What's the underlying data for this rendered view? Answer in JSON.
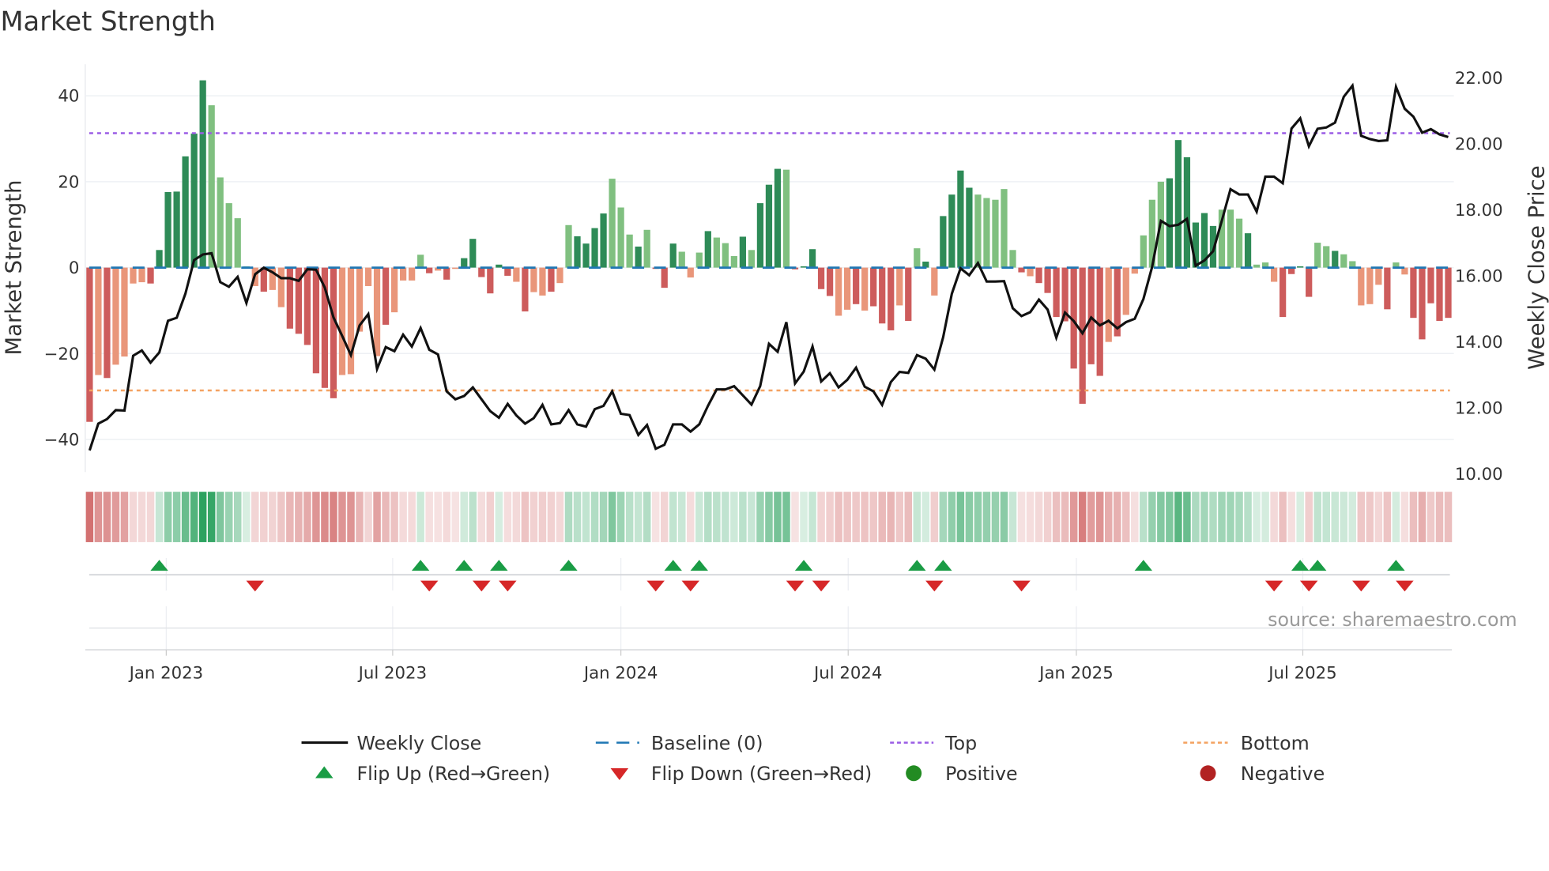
{
  "chart_data": {
    "type": "bar",
    "title": "Market Strength",
    "ylabel": "Market Strength",
    "y2label": "Weekly Close Price",
    "source": "source: sharemaestro.com",
    "ylim": [
      -44,
      47
    ],
    "y2lim": [
      10,
      22.3
    ],
    "yticks": [
      40,
      20,
      0,
      -20,
      -40
    ],
    "ytick_labels": [
      "40",
      "20",
      "0",
      "−20",
      "−40"
    ],
    "y2ticks": [
      22,
      20,
      18,
      16,
      14,
      12,
      10
    ],
    "y2tick_labels": [
      "22.00",
      "20.00",
      "18.00",
      "16.00",
      "14.00",
      "12.00",
      "10.00"
    ],
    "xticks": [
      {
        "label": "Jan 2023",
        "week": 8.8
      },
      {
        "label": "Jul 2023",
        "week": 34.8
      },
      {
        "label": "Jan 2024",
        "week": 61.0
      },
      {
        "label": "Jul 2024",
        "week": 87.1
      },
      {
        "label": "Jan 2025",
        "week": 113.3
      },
      {
        "label": "Jul 2025",
        "week": 139.3
      }
    ],
    "grid": true,
    "top_level": 31.3,
    "bottom_level": -28.6,
    "baseline": 0,
    "colors": {
      "positive_strong": "#2e8b57",
      "positive_weak": "#80c080",
      "negative_strong": "#cd5c5c",
      "negative_weak": "#e9967a",
      "price": "#111111",
      "baseline": "#1f77b4",
      "top": "#9b5de5",
      "bottom": "#f4a261",
      "flip_up": "#1a9c45",
      "flip_down": "#d62728",
      "positive_dot": "#228b22",
      "negative_dot": "#b22222"
    },
    "strength": [
      -35.9,
      -25,
      -25.7,
      -22.6,
      -20.7,
      -3.7,
      -3.4,
      -3.7,
      4.1,
      17.6,
      17.7,
      25.9,
      31.2,
      43.6,
      37.8,
      21,
      15,
      11.5,
      0.3,
      -4.3,
      -5.6,
      -5.2,
      -9.2,
      -14.2,
      -15.4,
      -18,
      -24.6,
      -28,
      -30.4,
      -25,
      -24.8,
      -14.9,
      -4.3,
      -20.6,
      -13.3,
      -10.4,
      -3,
      -3,
      3,
      -1.3,
      -0.7,
      -2.8,
      -0.3,
      2.2,
      6.7,
      -2.2,
      -6,
      0.7,
      -1.9,
      -3.3,
      -10.2,
      -5.7,
      -6.5,
      -5.6,
      -3.6,
      9.9,
      7.3,
      5.6,
      9.2,
      12.6,
      20.7,
      14,
      7.7,
      4.9,
      8.8,
      -0.3,
      -4.7,
      5.6,
      3.7,
      -2.3,
      3.5,
      8.5,
      7,
      5.7,
      2.7,
      7.2,
      4.1,
      15,
      19.3,
      23,
      22.8,
      -0.4,
      0.3,
      4.3,
      -5,
      -6.6,
      -11.2,
      -9.8,
      -8.5,
      -10,
      -9,
      -13,
      -14.6,
      -8.8,
      -12.4,
      4.5,
      1.4,
      -6.5,
      12,
      17,
      22.6,
      18.6,
      17,
      16.2,
      15.8,
      18.3,
      4.1,
      -1.1,
      -2,
      -3.6,
      -5.9,
      -11.5,
      -12.5,
      -23.5,
      -31.7,
      -22.5,
      -25.2,
      -17.3,
      -16,
      -11,
      -1.4,
      7.5,
      15.8,
      20,
      20.8,
      29.7,
      25.7,
      10.5,
      12.7,
      9.7,
      13.5,
      13.5,
      11.4,
      8,
      0.7,
      1.2,
      -3.3,
      -11.5,
      -1.5,
      0.3,
      -6.8,
      5.8,
      5,
      3.9,
      3.1,
      1.5,
      -8.8,
      -8.5,
      -4,
      -9.7,
      1.2,
      -1.6,
      -11.7,
      -16.7,
      -8.3,
      -12.4,
      -11.7
    ],
    "shade": "dldlllldddddddlllllldllddddddllllldlllldldlddddddldlldllddddllldldddllldllldldddldddddlldldddldldlddddllllldlddddddddldlllllddddddllldlllddddlldllllldlldddddlll",
    "weekly_close": [
      10.68,
      11.49,
      11.63,
      11.9,
      11.89,
      13.55,
      13.71,
      13.34,
      13.65,
      14.61,
      14.7,
      15.43,
      16.45,
      16.62,
      16.66,
      15.78,
      15.64,
      15.94,
      15.15,
      16.02,
      16.22,
      16.08,
      15.9,
      15.9,
      15.82,
      16.17,
      16.16,
      15.62,
      14.71,
      14.15,
      13.57,
      14.47,
      14.81,
      13.15,
      13.81,
      13.69,
      14.19,
      13.83,
      14.39,
      13.73,
      13.59,
      12.47,
      12.23,
      12.33,
      12.59,
      12.23,
      11.87,
      11.67,
      12.09,
      11.74,
      11.49,
      11.66,
      12.06,
      11.47,
      11.51,
      11.9,
      11.47,
      11.4,
      11.93,
      12.03,
      12.47,
      11.79,
      11.75,
      11.15,
      11.45,
      10.73,
      10.85,
      11.47,
      11.47,
      11.25,
      11.47,
      12.03,
      12.53,
      12.53,
      12.63,
      12.35,
      12.07,
      12.63,
      13.91,
      13.67,
      14.57,
      12.71,
      13.07,
      13.83,
      12.77,
      13.02,
      12.59,
      12.82,
      13.19,
      12.61,
      12.47,
      12.06,
      12.75,
      13.06,
      13.03,
      13.57,
      13.46,
      13.13,
      14.11,
      15.43,
      16.2,
      15.99,
      16.36,
      15.8,
      15.8,
      15.81,
      14.99,
      14.75,
      14.87,
      15.25,
      14.95,
      14.1,
      14.86,
      14.6,
      14.23,
      14.71,
      14.47,
      14.61,
      14.38,
      14.57,
      14.67,
      15.27,
      16.24,
      17.64,
      17.48,
      17.52,
      17.7,
      16.28,
      16.44,
      16.72,
      17.64,
      18.6,
      18.44,
      18.44,
      17.92,
      18.98,
      18.98,
      18.78,
      20.44,
      20.75,
      19.9,
      20.43,
      20.47,
      20.62,
      21.4,
      21.74,
      20.22,
      20.12,
      20.06,
      20.08,
      21.7,
      21.04,
      20.8,
      20.31,
      20.42,
      20.26,
      20.18
    ],
    "flip_up_weeks": [
      8,
      38,
      43,
      47,
      55,
      67,
      70,
      82,
      95,
      98,
      121,
      139,
      141,
      150
    ],
    "flip_down_weeks": [
      19,
      39,
      45,
      48,
      65,
      69,
      81,
      84,
      97,
      107,
      136,
      140,
      146,
      151
    ],
    "legend": [
      {
        "label": "Weekly Close",
        "kind": "line"
      },
      {
        "label": "Baseline (0)",
        "kind": "dash"
      },
      {
        "label": "Top",
        "kind": "dot-purple"
      },
      {
        "label": "Bottom",
        "kind": "dot-orange"
      },
      {
        "label": "Flip Up (Red→Green)",
        "kind": "triangle-up"
      },
      {
        "label": "Flip Down (Green→Red)",
        "kind": "triangle-down"
      },
      {
        "label": "Positive",
        "kind": "circle-green"
      },
      {
        "label": "Negative",
        "kind": "circle-red"
      }
    ],
    "legend_position": "bottom"
  }
}
